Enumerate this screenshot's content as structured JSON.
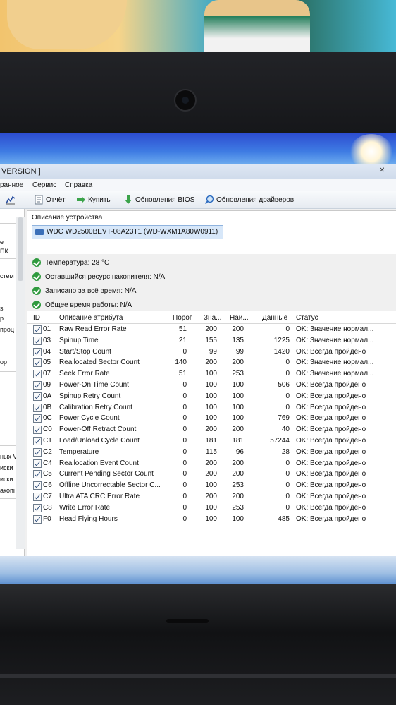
{
  "window": {
    "title": "VERSION ]",
    "close_glyph": "✕"
  },
  "menu": {
    "items": [
      "ранное",
      "Сервис",
      "Справка"
    ]
  },
  "toolbar": {
    "report": "Отчёт",
    "buy": "Купить",
    "bios": "Обновления BIOS",
    "drivers": "Обновления драйверов"
  },
  "sidebar": {
    "items": [
      "е",
      "ПК",
      "стем",
      "s",
      "р",
      "проц",
      "ор",
      "ных V",
      "иски",
      "иски",
      "акопі"
    ]
  },
  "device": {
    "header": "Описание устройства",
    "name": "WDC WD2500BEVT-08A23T1 (WD-WXM1A80W0911)"
  },
  "status": {
    "temperature": "Температура: 28 °C",
    "resource": "Оставшийся ресурс накопителя: N/A",
    "written": "Записано за всё время: N/A",
    "uptime": "Общее время работы: N/A"
  },
  "table": {
    "columns": {
      "id": "ID",
      "desc": "Описание атрибута",
      "threshold": "Порог",
      "value": "Зна...",
      "worst": "Наи...",
      "data": "Данные",
      "status": "Статус"
    },
    "rows": [
      {
        "id": "01",
        "desc": "Raw Read Error Rate",
        "threshold": "51",
        "value": "200",
        "worst": "200",
        "data": "0",
        "status": "OK: Значение нормал..."
      },
      {
        "id": "03",
        "desc": "Spinup Time",
        "threshold": "21",
        "value": "155",
        "worst": "135",
        "data": "1225",
        "status": "OK: Значение нормал..."
      },
      {
        "id": "04",
        "desc": "Start/Stop Count",
        "threshold": "0",
        "value": "99",
        "worst": "99",
        "data": "1420",
        "status": "OK: Всегда пройдено"
      },
      {
        "id": "05",
        "desc": "Reallocated Sector Count",
        "threshold": "140",
        "value": "200",
        "worst": "200",
        "data": "0",
        "status": "OK: Значение нормал..."
      },
      {
        "id": "07",
        "desc": "Seek Error Rate",
        "threshold": "51",
        "value": "100",
        "worst": "253",
        "data": "0",
        "status": "OK: Значение нормал..."
      },
      {
        "id": "09",
        "desc": "Power-On Time Count",
        "threshold": "0",
        "value": "100",
        "worst": "100",
        "data": "506",
        "status": "OK: Всегда пройдено"
      },
      {
        "id": "0A",
        "desc": "Spinup Retry Count",
        "threshold": "0",
        "value": "100",
        "worst": "100",
        "data": "0",
        "status": "OK: Всегда пройдено"
      },
      {
        "id": "0B",
        "desc": "Calibration Retry Count",
        "threshold": "0",
        "value": "100",
        "worst": "100",
        "data": "0",
        "status": "OK: Всегда пройдено"
      },
      {
        "id": "0C",
        "desc": "Power Cycle Count",
        "threshold": "0",
        "value": "100",
        "worst": "100",
        "data": "769",
        "status": "OK: Всегда пройдено"
      },
      {
        "id": "C0",
        "desc": "Power-Off Retract Count",
        "threshold": "0",
        "value": "200",
        "worst": "200",
        "data": "40",
        "status": "OK: Всегда пройдено"
      },
      {
        "id": "C1",
        "desc": "Load/Unload Cycle Count",
        "threshold": "0",
        "value": "181",
        "worst": "181",
        "data": "57244",
        "status": "OK: Всегда пройдено"
      },
      {
        "id": "C2",
        "desc": "Temperature",
        "threshold": "0",
        "value": "115",
        "worst": "96",
        "data": "28",
        "status": "OK: Всегда пройдено"
      },
      {
        "id": "C4",
        "desc": "Reallocation Event Count",
        "threshold": "0",
        "value": "200",
        "worst": "200",
        "data": "0",
        "status": "OK: Всегда пройдено"
      },
      {
        "id": "C5",
        "desc": "Current Pending Sector Count",
        "threshold": "0",
        "value": "200",
        "worst": "200",
        "data": "0",
        "status": "OK: Всегда пройдено"
      },
      {
        "id": "C6",
        "desc": "Offline Uncorrectable Sector C...",
        "threshold": "0",
        "value": "100",
        "worst": "253",
        "data": "0",
        "status": "OK: Всегда пройдено"
      },
      {
        "id": "C7",
        "desc": "Ultra ATA CRC Error Rate",
        "threshold": "0",
        "value": "200",
        "worst": "200",
        "data": "0",
        "status": "OK: Всегда пройдено"
      },
      {
        "id": "C8",
        "desc": "Write Error Rate",
        "threshold": "0",
        "value": "100",
        "worst": "253",
        "data": "0",
        "status": "OK: Всегда пройдено"
      },
      {
        "id": "F0",
        "desc": "Head Flying Hours",
        "threshold": "0",
        "value": "100",
        "worst": "100",
        "data": "485",
        "status": "OK: Всегда пройдено"
      }
    ]
  },
  "colors": {
    "selection": "#d7e7f9",
    "ok_green": "#2f9a3e",
    "taskbar_blue": "#3e7be3"
  }
}
